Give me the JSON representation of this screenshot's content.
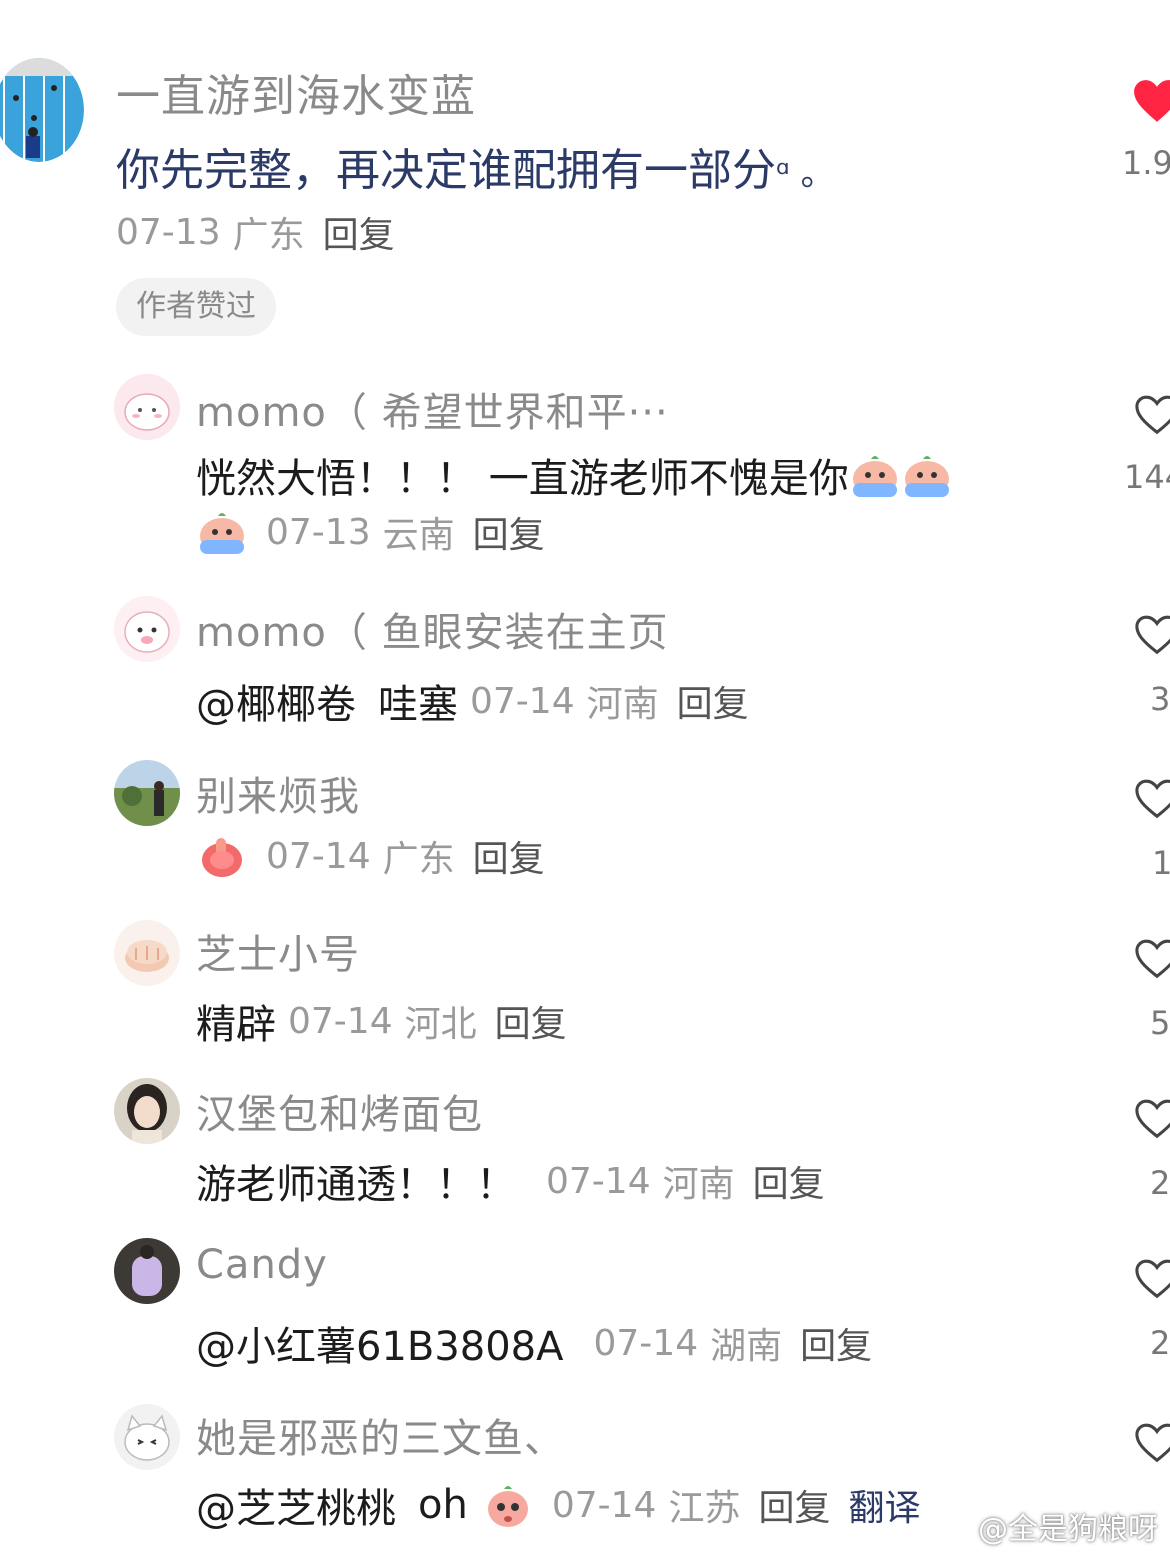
{
  "main_comment": {
    "author": "一直游到海水变蓝",
    "text": "你先完整，再决定谁配拥有一部分",
    "text_suffix": "ᵅ 。",
    "date": "07-13",
    "location": "广东",
    "reply_label": "回复",
    "badge": "作者赞过",
    "like_count": "1.9",
    "liked": true
  },
  "replies": [
    {
      "author": "momo（ 希望世界和平···",
      "text": "恍然大悟！！！ 一直游老师不愧是你",
      "emoji": [
        "crying-peach-emoji",
        "crying-peach-emoji",
        "crying-peach-emoji"
      ],
      "date": "07-13",
      "location": "云南",
      "reply_label": "回复",
      "like_count": "144"
    },
    {
      "author": "momo（ 鱼眼安装在主页",
      "mention": "@椰椰卷",
      "text": "哇塞",
      "date": "07-14",
      "location": "河南",
      "reply_label": "回复",
      "like_count": "3"
    },
    {
      "author": "别来烦我",
      "emoji": [
        "thumbs-up-peach-emoji"
      ],
      "date": "07-14",
      "location": "广东",
      "reply_label": "回复",
      "like_count": "1"
    },
    {
      "author": "芝士小号",
      "text": "精辟",
      "date": "07-14",
      "location": "河北",
      "reply_label": "回复",
      "like_count": "5"
    },
    {
      "author": "汉堡包和烤面包",
      "text": "游老师通透！！！",
      "date": "07-14",
      "location": "河南",
      "reply_label": "回复",
      "like_count": "2"
    },
    {
      "author": "Candy",
      "mention": "@小红薯61B3808A",
      "date": "07-14",
      "location": "湖南",
      "reply_label": "回复",
      "like_count": "2"
    },
    {
      "author": "她是邪恶的三文鱼、",
      "mention": "@芝芝桃桃",
      "text": "oh",
      "emoji": [
        "shocked-peach-emoji"
      ],
      "date": "07-14",
      "location": "江苏",
      "reply_label": "回复",
      "translate_label": "翻译"
    }
  ],
  "watermark": "@全是狗粮呀",
  "colors": {
    "like_red": "#ff2442",
    "gray_text": "#8a8a8a",
    "meta_gray": "#9a9a9a"
  }
}
